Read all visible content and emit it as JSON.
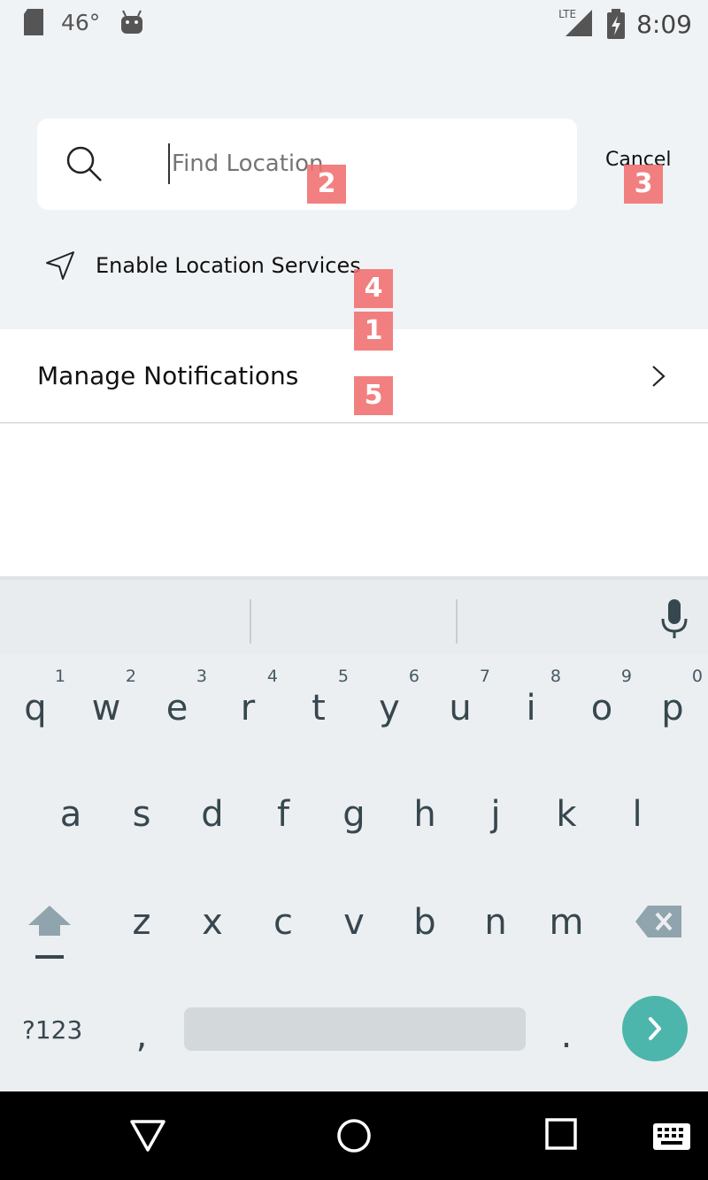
{
  "status_bar": {
    "temperature": "46°",
    "network": "LTE",
    "time": "8:09"
  },
  "search": {
    "placeholder": "Find Location",
    "cancel_label": "Cancel"
  },
  "location": {
    "label": "Enable Location Services"
  },
  "notifications": {
    "label": "Manage Notifications"
  },
  "keyboard": {
    "row1": [
      {
        "key": "q",
        "hint": "1"
      },
      {
        "key": "w",
        "hint": "2"
      },
      {
        "key": "e",
        "hint": "3"
      },
      {
        "key": "r",
        "hint": "4"
      },
      {
        "key": "t",
        "hint": "5"
      },
      {
        "key": "y",
        "hint": "6"
      },
      {
        "key": "u",
        "hint": "7"
      },
      {
        "key": "i",
        "hint": "8"
      },
      {
        "key": "o",
        "hint": "9"
      },
      {
        "key": "p",
        "hint": "0"
      }
    ],
    "row2": [
      "a",
      "s",
      "d",
      "f",
      "g",
      "h",
      "j",
      "k",
      "l"
    ],
    "row3": [
      "z",
      "x",
      "c",
      "v",
      "b",
      "n",
      "m"
    ],
    "symbols_label": "?123",
    "comma": ",",
    "period": "."
  },
  "markers": [
    "1",
    "2",
    "3",
    "4",
    "5"
  ],
  "colors": {
    "accent_go": "#4db6ac",
    "marker": "#f06e6e"
  }
}
